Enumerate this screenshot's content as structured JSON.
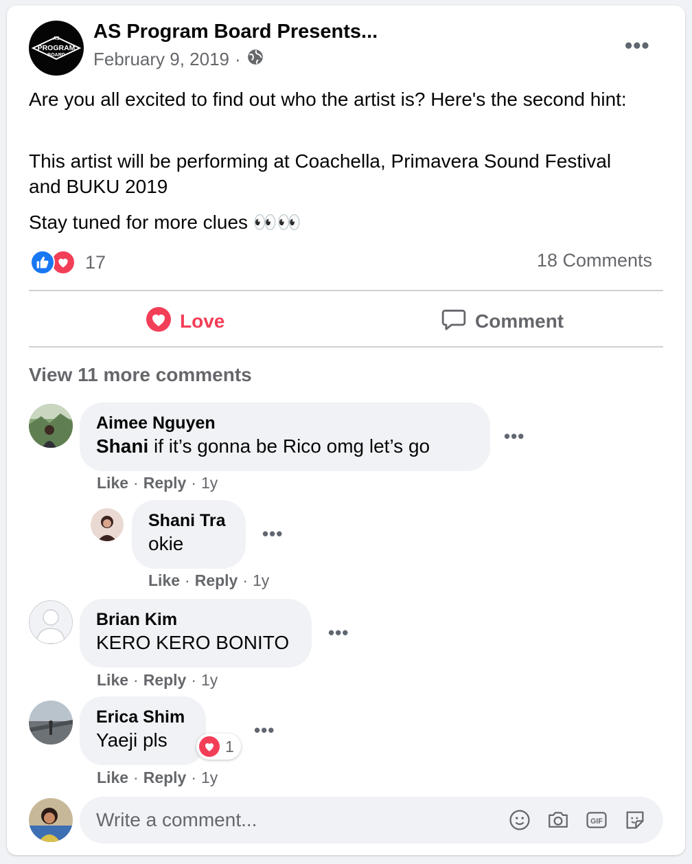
{
  "post": {
    "page_name": "AS Program Board Presents...",
    "logo_top": "AS",
    "logo_main": "PROGRAM",
    "logo_bottom": "BOARD",
    "date": "February 9, 2019",
    "separator": "·",
    "paragraphs": [
      "Are you all excited to find out who the artist is? Here's the second hint:",
      "This artist will be performing at Coachella, Primavera Sound Festival and BUKU 2019",
      "Stay tuned for more clues 👀👀"
    ],
    "reaction_count": "17",
    "comments_count": "18 Comments"
  },
  "actions": {
    "love_label": "Love",
    "comment_label": "Comment"
  },
  "view_more": "View 11 more comments",
  "comments": [
    {
      "author": "Aimee Nguyen",
      "mention": "Shani",
      "text": " if it’s gonna be Rico omg let’s go",
      "like": "Like",
      "reply": "Reply",
      "time": "1y"
    },
    {
      "author": "Shani Tra",
      "text": "okie",
      "like": "Like",
      "reply": "Reply",
      "time": "1y"
    },
    {
      "author": "Brian Kim",
      "text": "KERO KERO BONITO",
      "like": "Like",
      "reply": "Reply",
      "time": "1y"
    },
    {
      "author": "Erica Shim",
      "text": "Yaeji pls",
      "reaction_count": "1",
      "like": "Like",
      "reply": "Reply",
      "time": "1y"
    }
  ],
  "composer": {
    "placeholder": "Write a comment..."
  },
  "icons": {
    "globe": "globe-icon",
    "like_reaction": "thumbs-up-icon",
    "love_reaction": "heart-icon",
    "comment": "speech-bubble-icon",
    "emoji": "smiley-icon",
    "camera": "camera-icon",
    "gif": "gif-icon",
    "sticker": "sticker-icon"
  },
  "colors": {
    "love": "#f33e58",
    "like": "#1877f2",
    "muted": "#65676b",
    "bubble": "#f0f2f5"
  }
}
